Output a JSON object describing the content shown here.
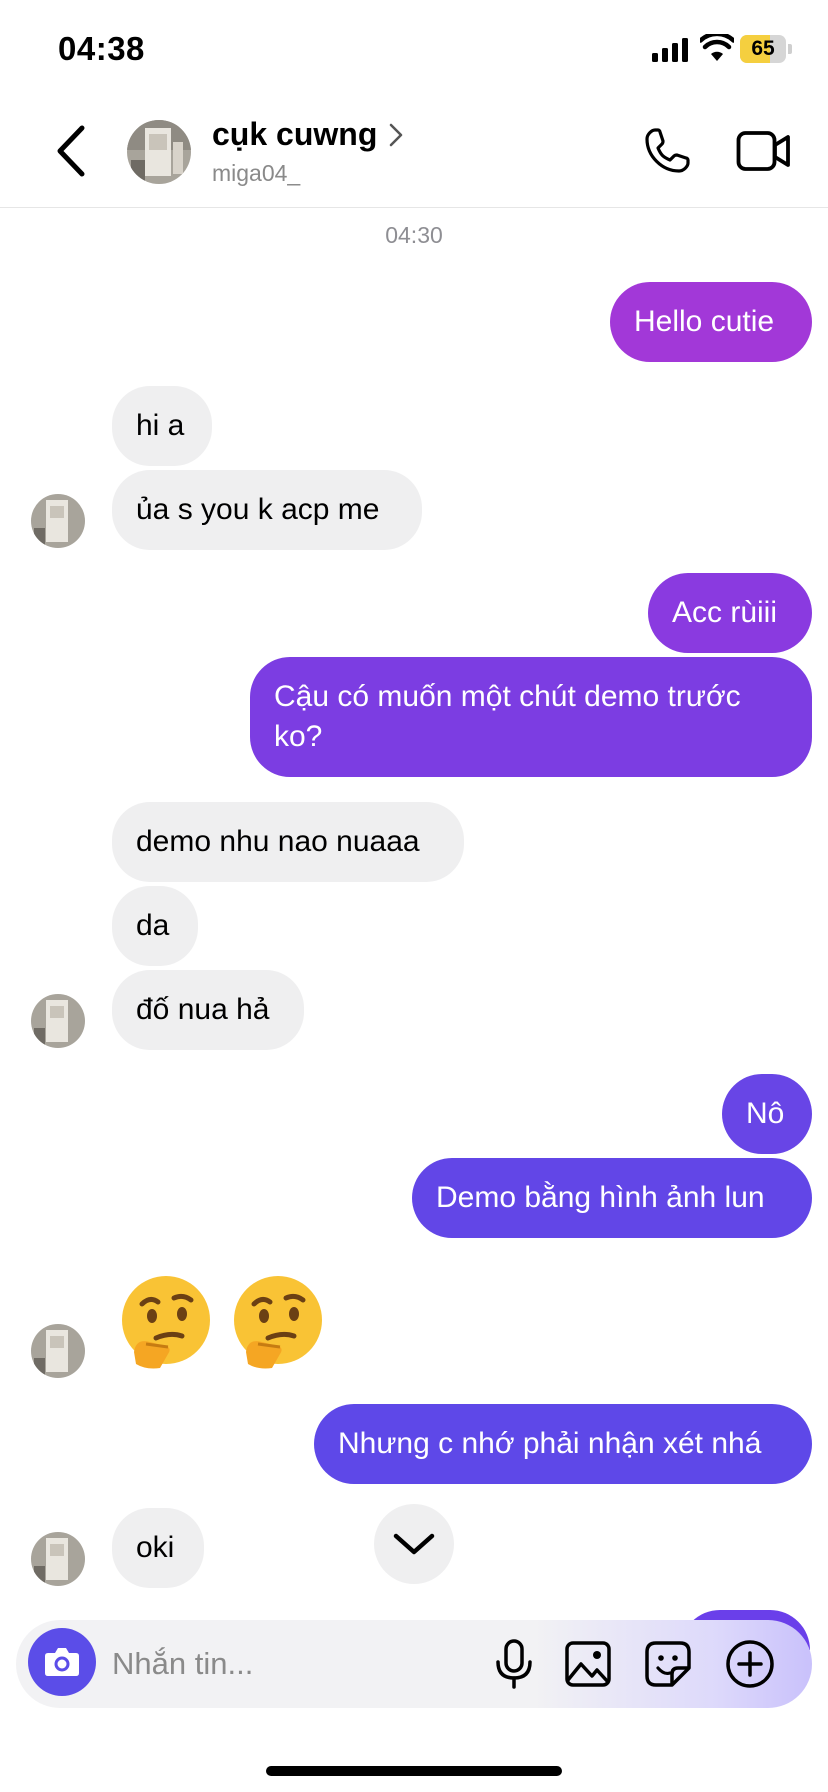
{
  "status_bar": {
    "time": "04:38",
    "battery": "65",
    "battery_level": 0.65
  },
  "header": {
    "contact_name": "cụk cuwng",
    "username": "miga04_",
    "icons": {
      "back": "chevron-left-icon",
      "call": "phone-icon",
      "video": "video-camera-icon"
    }
  },
  "chat": {
    "timestamp": "04:30",
    "messages": [
      {
        "dir": "out",
        "text": "Hello cutie"
      },
      {
        "dir": "in",
        "text": "hi a"
      },
      {
        "dir": "in",
        "text": "ủa s you k acp me"
      },
      {
        "dir": "out",
        "text": "Acc rùiii"
      },
      {
        "dir": "out",
        "text": "Cậu có muốn một chút demo trước ko?"
      },
      {
        "dir": "in",
        "text": "demo nhu nao nuaaa"
      },
      {
        "dir": "in",
        "text": "da"
      },
      {
        "dir": "in",
        "text": "đố nua hả"
      },
      {
        "dir": "out",
        "text": "Nô"
      },
      {
        "dir": "out",
        "text": "Demo bằng hình ảnh lun"
      },
      {
        "dir": "in",
        "text": "🤔🤔",
        "emoji_name": "thinking-face"
      },
      {
        "dir": "out",
        "text": "Nhưng c nhớ phải nhận xét nhá"
      },
      {
        "dir": "in",
        "text": "oki"
      }
    ]
  },
  "composer": {
    "placeholder": "Nhắn tin...",
    "icons": [
      "camera-icon",
      "microphone-icon",
      "gallery-icon",
      "sticker-icon",
      "plus-icon"
    ]
  },
  "colors": {
    "bubble_incoming": "#efeff0",
    "bubble_gradient_top": "#9b3ddc",
    "bubble_gradient_bottom": "#5f47e8",
    "camera_button": "#5b4de8",
    "battery": "#f5cf3f"
  }
}
